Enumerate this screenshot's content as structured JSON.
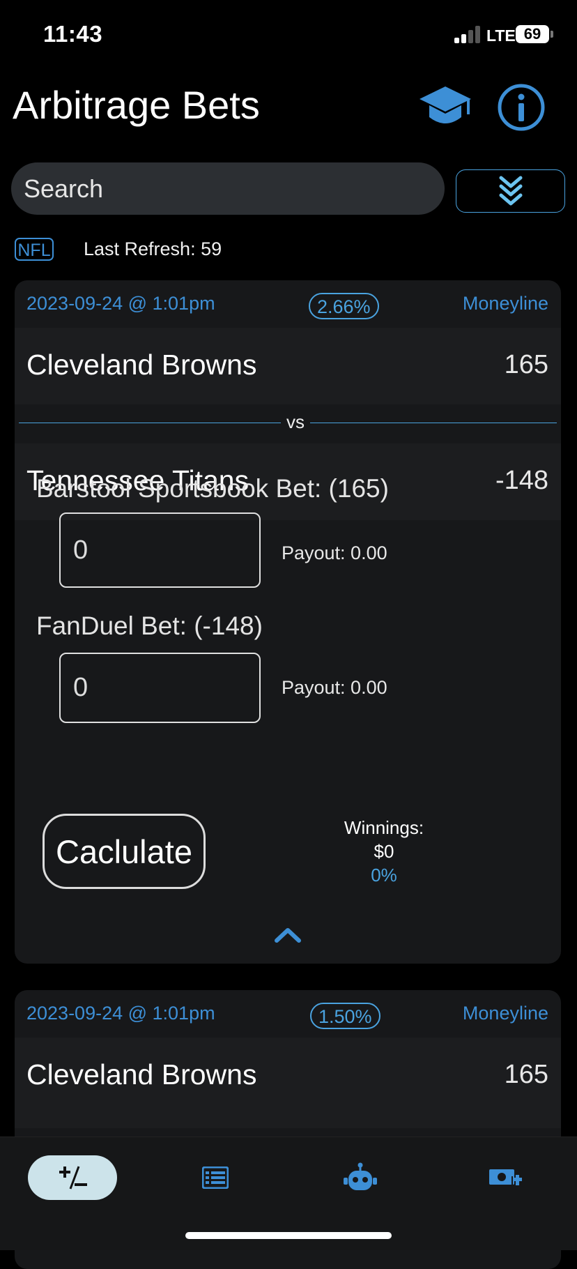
{
  "status_bar": {
    "time": "11:43",
    "network": "LTE",
    "battery": "69"
  },
  "header": {
    "title": "Arbitrage Bets",
    "learn_icon": "graduation-cap-icon",
    "info_icon": "info-circle-icon"
  },
  "search": {
    "placeholder": "Search",
    "value": ""
  },
  "filter": {
    "league": "NFL",
    "last_refresh_label": "Last Refresh: 59"
  },
  "cards": [
    {
      "date": "2023-09-24 @ 1:01pm",
      "percent": "2.66%",
      "bet_type": "Moneyline",
      "team1": {
        "name": "Cleveland Browns",
        "odds": "165"
      },
      "vs": "vs",
      "team2": {
        "name": "Tennessee Titans",
        "odds": "-148"
      },
      "bet1": {
        "label": "Barstool Sportsbook Bet: (165)",
        "value": "0",
        "payout": "Payout: 0.00"
      },
      "bet2": {
        "label": "FanDuel Bet: (-148)",
        "value": "0",
        "payout": "Payout: 0.00"
      },
      "calculate_label": "Caclulate",
      "winnings": {
        "label": "Winnings:",
        "amount": "$0",
        "percent": "0%"
      }
    },
    {
      "date": "2023-09-24 @ 1:01pm",
      "percent": "1.50%",
      "bet_type": "Moneyline",
      "team1": {
        "name": "Cleveland Browns",
        "odds": "165"
      }
    }
  ],
  "tab_bar": {
    "tabs": [
      {
        "icon": "plus-minus-icon",
        "active": true
      },
      {
        "icon": "list-icon",
        "active": false
      },
      {
        "icon": "robot-icon",
        "active": false
      },
      {
        "icon": "money-add-icon",
        "active": false
      }
    ]
  },
  "colors": {
    "accent": "#3d8fd6",
    "accent_light": "#4aa3e0",
    "active_tab": "#cce3ea",
    "background": "#000000",
    "card": "#17181a"
  }
}
